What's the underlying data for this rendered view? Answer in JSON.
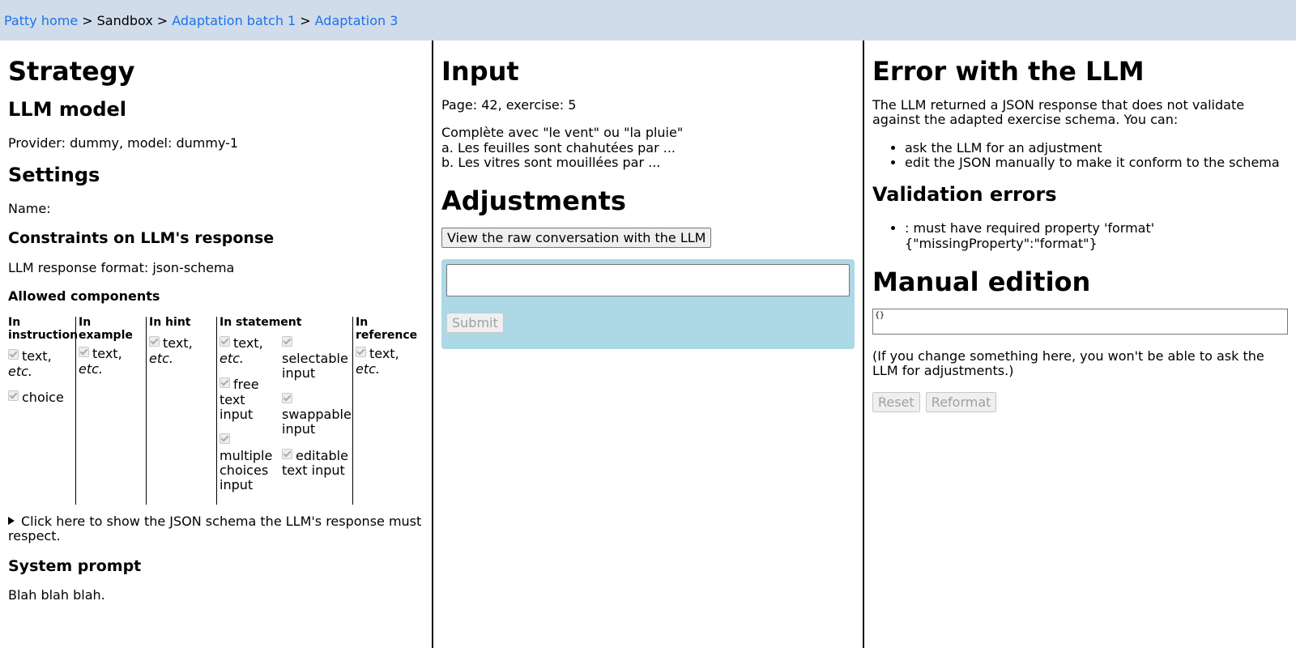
{
  "breadcrumb": {
    "items": [
      {
        "label": "Patty home",
        "link": true
      },
      {
        "label": "Sandbox",
        "link": false
      },
      {
        "label": "Adaptation batch 1",
        "link": true
      },
      {
        "label": "Adaptation 3",
        "link": true
      }
    ],
    "separator": ">"
  },
  "strategy": {
    "title": "Strategy",
    "llm_model_heading": "LLM model",
    "llm_model_text": "Provider: dummy, model: dummy-1",
    "settings_heading": "Settings",
    "name_label": "Name:",
    "constraints_heading": "Constraints on LLM's response",
    "format_text": "LLM response format: json-schema",
    "allowed_heading": "Allowed components",
    "components": {
      "instruction": {
        "header": "In instruction",
        "items": [
          "text, ",
          "choice"
        ],
        "etc": "etc."
      },
      "example": {
        "header": "In example",
        "items": [
          "text, "
        ],
        "etc": "etc."
      },
      "hint": {
        "header": "In hint",
        "items": [
          "text, "
        ],
        "etc": "etc."
      },
      "statement": {
        "header": "In statement",
        "left": [
          "text, ",
          "free text input",
          "multiple choices input"
        ],
        "right": [
          "selectable input",
          "swappable input",
          "editable text input"
        ],
        "etc": "etc."
      },
      "reference": {
        "header": "In reference",
        "items": [
          "text, "
        ],
        "etc": "etc."
      }
    },
    "schema_toggle": "Click here to show the JSON schema the LLM's response must respect.",
    "system_prompt_heading": "System prompt",
    "system_prompt_text": "Blah blah blah."
  },
  "input": {
    "title": "Input",
    "page_exercise": "Page: 42, exercise: 5",
    "lines": [
      "Complète avec \"le vent\" ou \"la pluie\"",
      "a. Les feuilles sont chahutées par ...",
      "b. Les vitres sont mouillées par ..."
    ],
    "adjustments_heading": "Adjustments",
    "raw_button": "View the raw conversation with the LLM",
    "adjust_value": "",
    "submit_label": "Submit"
  },
  "error": {
    "title": "Error with the LLM",
    "description": "The LLM returned a JSON response that does not validate against the adapted exercise schema. You can:",
    "options": [
      "ask the LLM for an adjustment",
      "edit the JSON manually to make it conform to the schema"
    ],
    "validation_heading": "Validation errors",
    "validation_items": [
      ": must have required property 'format' {\"missingProperty\":\"format\"}"
    ],
    "manual_heading": "Manual edition",
    "manual_value": "{}",
    "manual_note": "(If you change something here, you won't be able to ask the LLM for adjustments.)",
    "reset_label": "Reset",
    "reformat_label": "Reformat"
  },
  "colors": {
    "topbar": "#d1dceb",
    "link": "#1a73e8",
    "adjust_box": "#add8e6"
  }
}
